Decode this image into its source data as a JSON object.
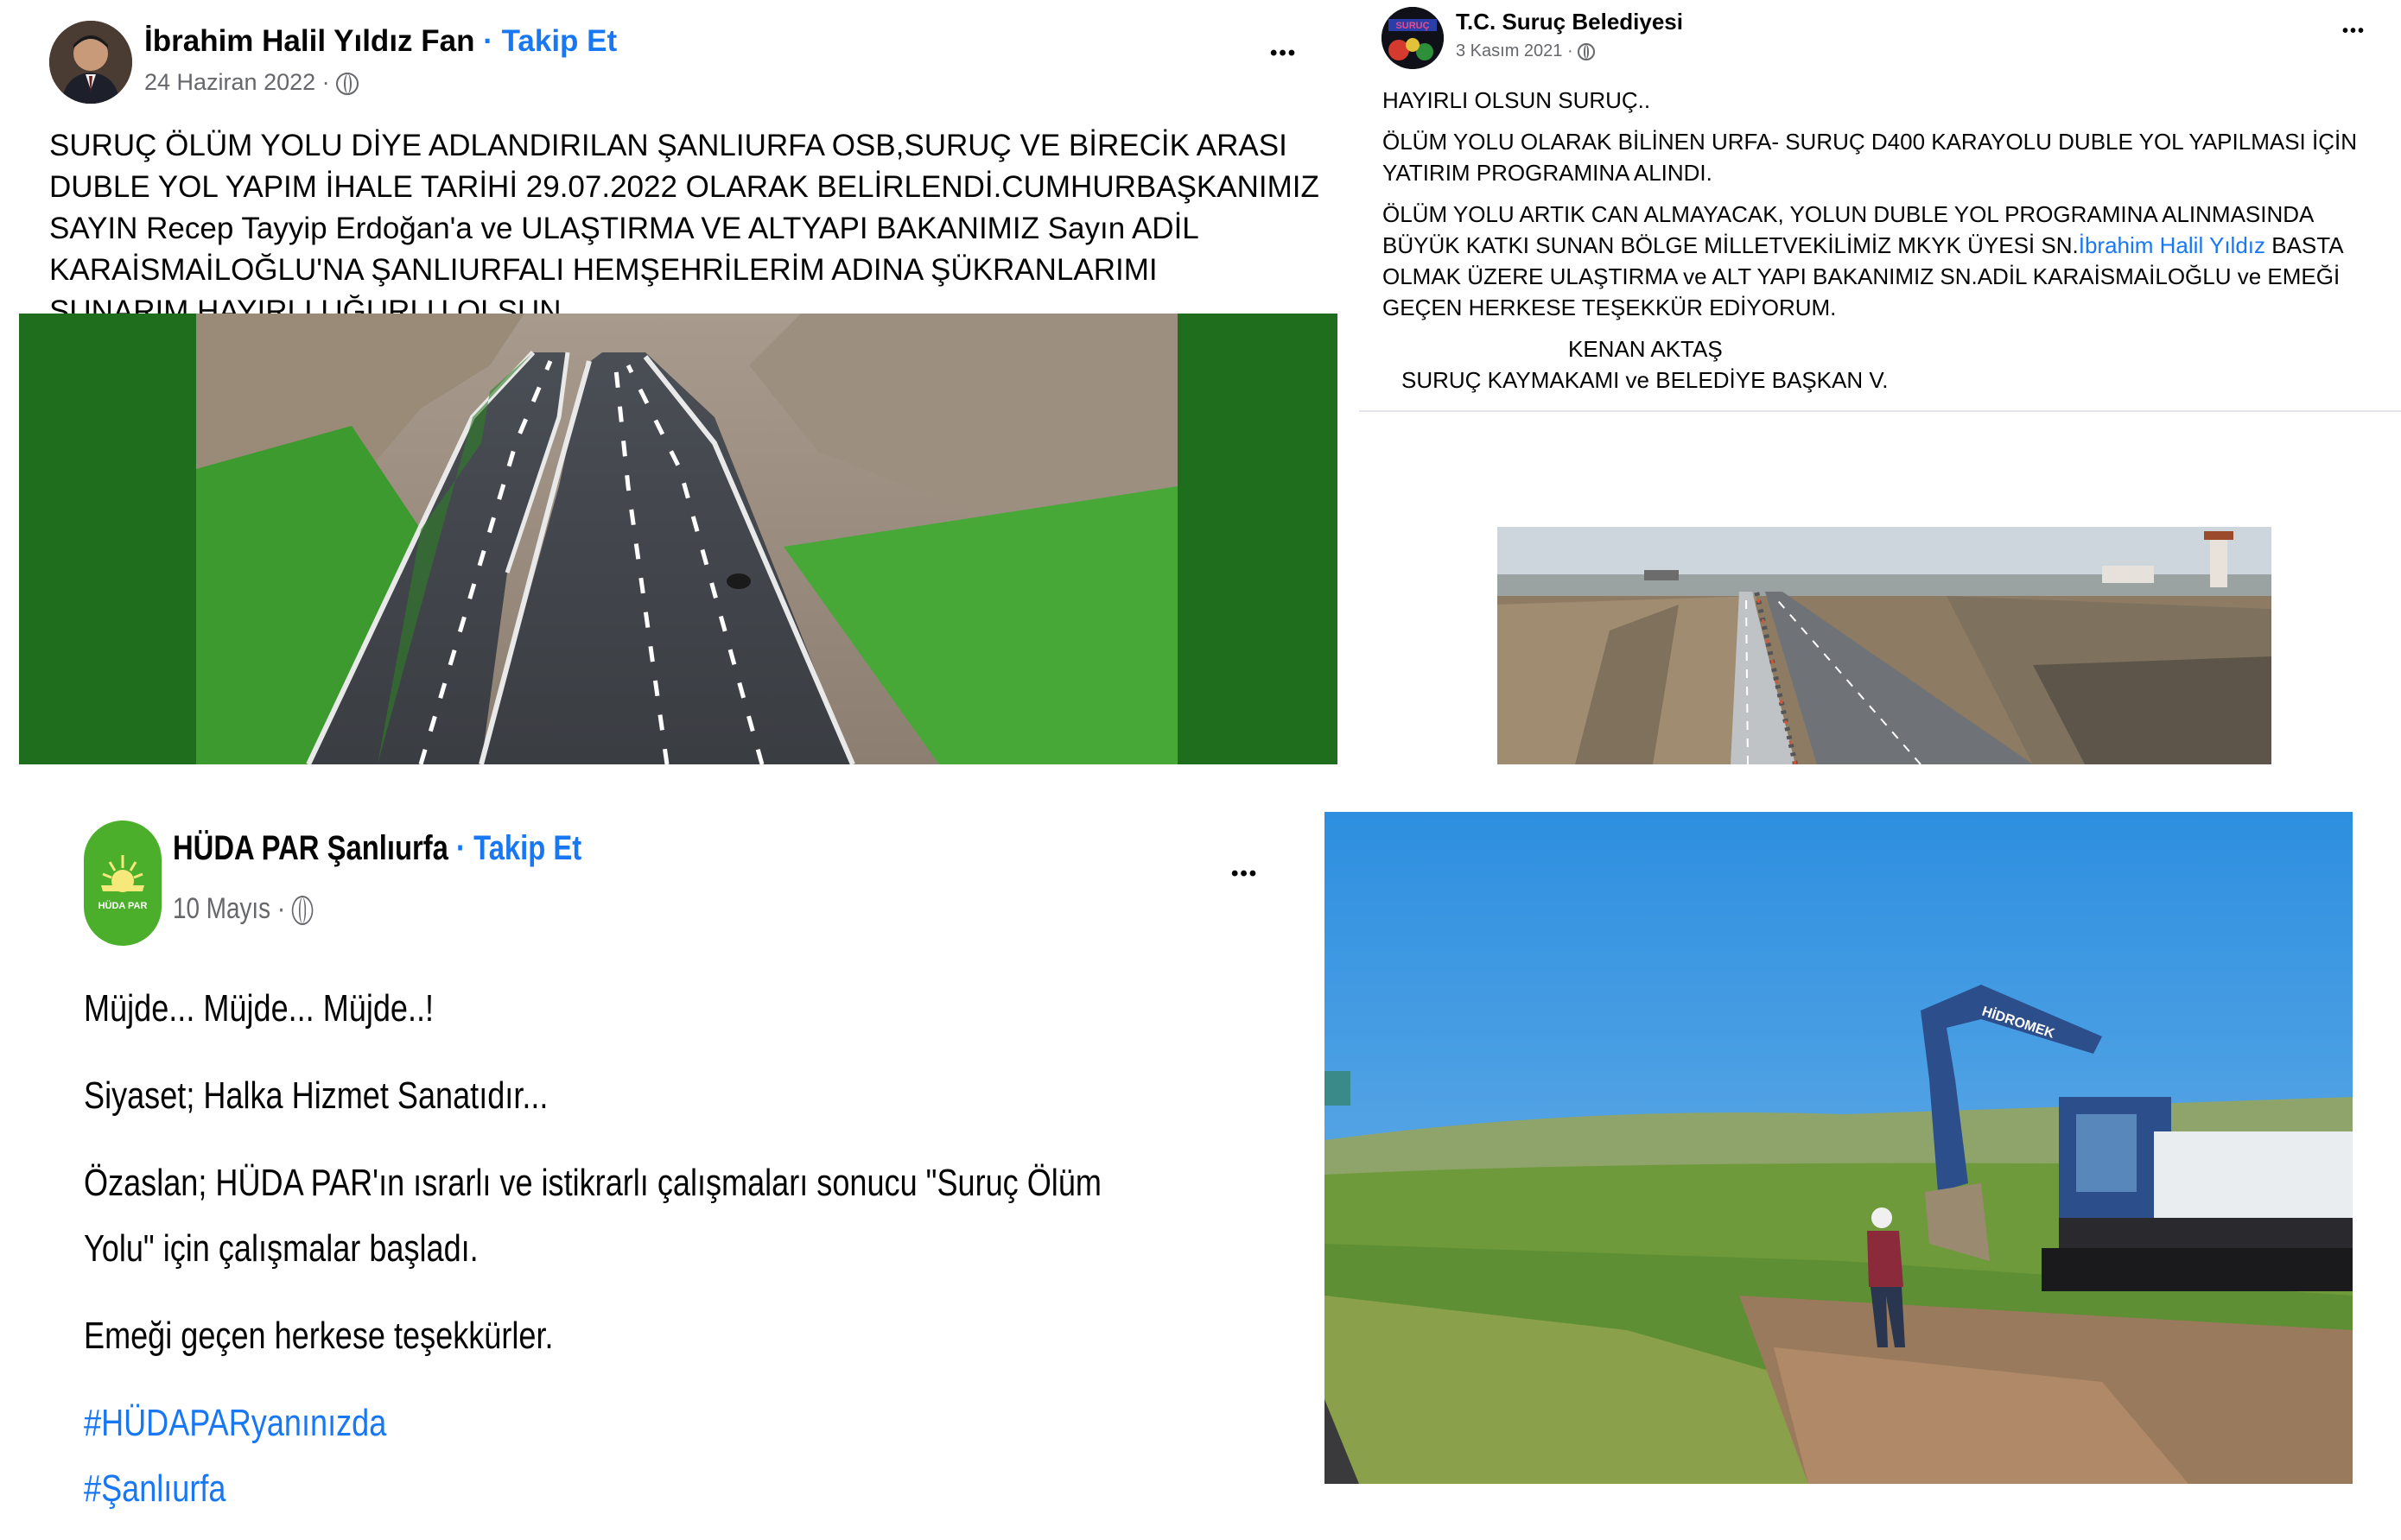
{
  "post1": {
    "author": "İbrahim Halil Yıldız Fan",
    "follow": "· Takip Et",
    "date": "24 Haziran 2022 ·",
    "more": "•••",
    "body": "SURUÇ ÖLÜM YOLU DİYE ADLANDIRILAN ŞANLIURFA OSB,SURUÇ VE BİRECİK ARASI DUBLE YOL YAPIM İHALE TARİHİ 29.07.2022 OLARAK BELİRLENDİ.CUMHURBAŞKANIMIZ SAYIN Recep Tayyip Erdoğan'a ve ULAŞTIRMA VE ALTYAPI BAKANIMIZ Sayın ADİL KARAİSMAİLOĞLU'NA ŞANLIURFALI HEMŞEHRİLERİM ADINA ŞÜKRANLARIMI SUNARIM.HAYIRLI UĞURLU OLSUN"
  },
  "post2": {
    "author": "T.C. Suruç Belediyesi",
    "avatar_text": "SURUÇ",
    "date": "3 Kasım 2021 ·",
    "more": "•••",
    "line1": "HAYIRLI OLSUN SURUÇ..",
    "line2": "ÖLÜM YOLU OLARAK BİLİNEN URFA-  SURUÇ D400 KARAYOLU DUBLE YOL YAPILMASI İÇİN YATIRIM PROGRAMINA ALINDI.",
    "line3_a": "ÖLÜM YOLU ARTIK CAN ALMAYACAK, YOLUN DUBLE YOL PROGRAMINA ALINMASINDA BÜYÜK KATKI SUNAN  BÖLGE MİLLETVEKİLİMİZ MKYK ÜYESİ SN.",
    "line3_link": "İbrahim Halil Yıldız",
    "line3_b": " BASTA OLMAK ÜZERE ULAŞTIRMA ve ALT YAPI  BAKANIMIZ SN.ADİL KARAİSMAİLOĞLU ve EMEĞİ GEÇEN HERKESE TEŞEKKÜR EDİYORUM.",
    "sign1": "KENAN AKTAŞ",
    "sign2": "SURUÇ KAYMAKAMI ve BELEDİYE BAŞKAN V."
  },
  "post3": {
    "author": "HÜDA PAR Şanlıurfa",
    "follow": "· Takip Et",
    "avatar_text": "HÜDA PAR",
    "date": "10 Mayıs ·",
    "more": "•••",
    "p1": "Müjde... Müjde... Müjde..!",
    "p2": "Siyaset; Halka Hizmet Sanatıdır...",
    "p3": "Özaslan; HÜDA PAR'ın ısrarlı ve istikrarlı çalışmaları sonucu \"Suruç Ölüm Yolu\" için çalışmalar başladı.",
    "p4": "Emeği geçen herkese teşekkürler.",
    "tag1": "#HÜDAPARyanınızda",
    "tag2": "#Şanlıurfa"
  },
  "photo": {
    "excavator_brand": "HİDROMEK"
  }
}
